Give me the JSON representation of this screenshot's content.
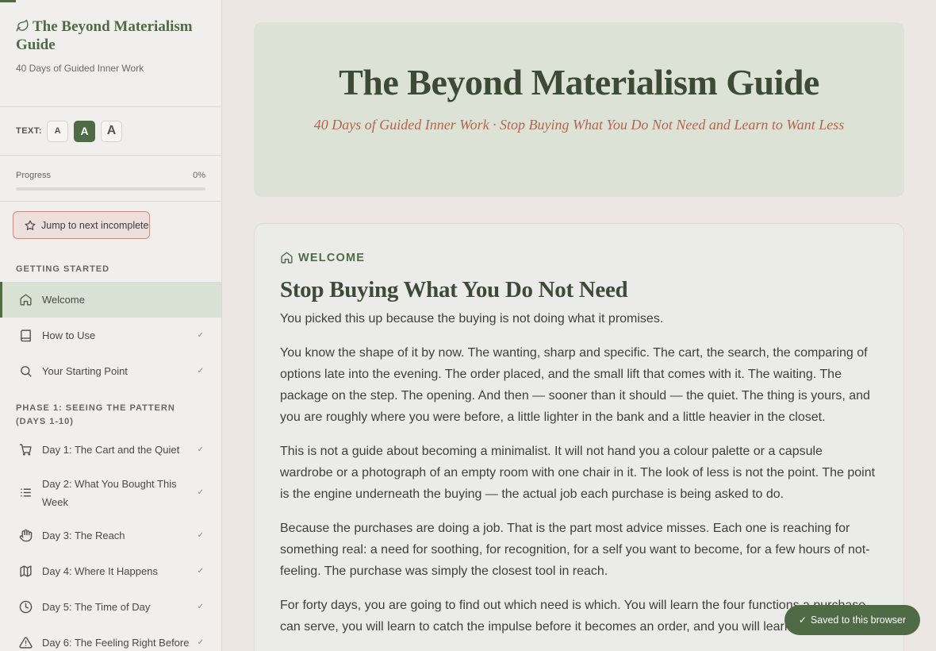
{
  "sidebar": {
    "title": "The Beyond Materialism Guide",
    "subtitle": "40 Days of Guided Inner Work",
    "text_size": {
      "label": "TEXT:",
      "options": [
        "A",
        "A",
        "A"
      ],
      "selected_index": 1
    },
    "progress": {
      "label": "Progress",
      "value_text": "0%",
      "fraction": 0
    },
    "jump_label": "Jump to next incomplete",
    "sections": [
      {
        "label": "GETTING STARTED",
        "items": [
          {
            "label": "Welcome",
            "icon": "home-icon",
            "active": true,
            "check": ""
          },
          {
            "label": "How to Use",
            "icon": "book-icon",
            "active": false,
            "check": "✓"
          },
          {
            "label": "Your Starting Point",
            "icon": "search-icon",
            "active": false,
            "check": "✓"
          }
        ]
      },
      {
        "label": "PHASE 1: SEEING THE PATTERN (DAYS 1-10)",
        "items": [
          {
            "label": "Day 1: The Cart and the Quiet",
            "icon": "cart-icon",
            "check": "✓"
          },
          {
            "label": "Day 2: What You Bought This Week",
            "icon": "list-icon",
            "check": "✓"
          },
          {
            "label": "Day 3: The Reach",
            "icon": "hand-icon",
            "check": "✓"
          },
          {
            "label": "Day 4: Where It Happens",
            "icon": "map-icon",
            "check": "✓"
          },
          {
            "label": "Day 5: The Time of Day",
            "icon": "clock-icon",
            "check": "✓"
          },
          {
            "label": "Day 6: The Feeling Right Before",
            "icon": "alert-icon",
            "check": "✓"
          }
        ]
      }
    ]
  },
  "hero": {
    "title": "The Beyond Materialism Guide",
    "subtitle": "40 Days of Guided Inner Work · Stop Buying What You Do Not Need and Learn to Want Less"
  },
  "content": {
    "kicker": "WELCOME",
    "title": "Stop Buying What You Do Not Need",
    "paragraphs": [
      "You picked this up because the buying is not doing what it promises.",
      "You know the shape of it by now. The wanting, sharp and specific. The cart, the search, the comparing of options late into the evening. The order placed, and the small lift that comes with it. The waiting. The package on the step. The opening. And then — sooner than it should — the quiet. The thing is yours, and you are roughly where you were before, a little lighter in the bank and a little heavier in the closet.",
      "This is not a guide about becoming a minimalist. It will not hand you a colour palette or a capsule wardrobe or a photograph of an empty room with one chair in it. The look of less is not the point. The point is the engine underneath the buying — the actual job each purchase is being asked to do.",
      "Because the purchases are doing a job. That is the part most advice misses. Each one is reaching for something real: a need for soothing, for recognition, for a self you want to become, for a few hours of not-feeling. The purchase was simply the closest tool in reach.",
      "For forty days, you are going to find out which need is which. You will learn the four functions a purchase can serve, you will learn to catch the impulse before it becomes an order, and you will learn to meet the"
    ]
  },
  "toast": {
    "label": "Saved to this browser"
  }
}
